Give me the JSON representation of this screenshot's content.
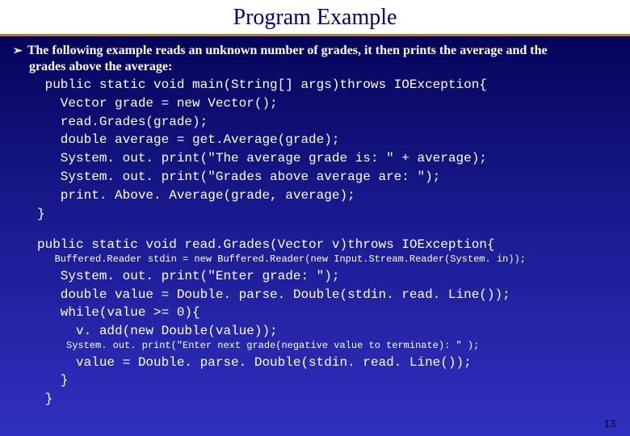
{
  "title": "Program Example",
  "bullet": {
    "line1": "The following example reads an unknown number of grades, it then prints the average and the",
    "line2": "grades above the average:"
  },
  "code1": {
    "l1": " public static void main(String[] args)throws IOException{",
    "l2": "   Vector grade = new Vector();",
    "l3": "   read.Grades(grade);",
    "l4": "   double average = get.Average(grade);",
    "l5": "   System. out. print(\"The average grade is: \" + average);",
    "l6": "   System. out. print(\"Grades above average are: \");",
    "l7": "   print. Above. Average(grade, average);",
    "l8": "}"
  },
  "code2": {
    "l1": "public static void read.Grades(Vector v)throws IOException{",
    "l2": "   Buffered.Reader stdin = new Buffered.Reader(new Input.Stream.Reader(System. in));",
    "l3": "   System. out. print(\"Enter grade: \");",
    "l4": "   double value = Double. parse. Double(stdin. read. Line());",
    "l5": "   while(value >= 0){",
    "l6": "     v. add(new Double(value));",
    "l7": "     System. out. print(\"Enter next grade(negative value to terminate): \" );",
    "l8": "     value = Double. parse. Double(stdin. read. Line());",
    "l9": "   }",
    "l10": " }"
  },
  "pageNumber": "13"
}
